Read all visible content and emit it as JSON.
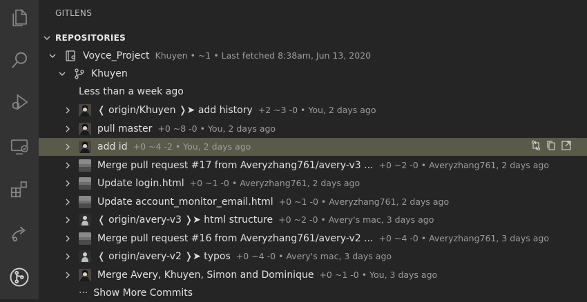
{
  "activity_icons": [
    "files-icon",
    "search-icon",
    "run-debug-icon",
    "remote-explorer-icon",
    "extensions-icon",
    "live-share-icon",
    "gitlens-icon"
  ],
  "header": {
    "title": "GITLENS"
  },
  "section": {
    "label": "REPOSITORIES"
  },
  "repo": {
    "name": "Voyce_Project",
    "meta": "Khuyen • ~1 • Last fetched 8:38am, Jun 13, 2020"
  },
  "branch": {
    "name": "Khuyen"
  },
  "group": {
    "label": "Less than a week ago"
  },
  "commits": [
    {
      "msg": "❬ origin/Khuyen ❭➤ add history",
      "meta": "+2 ~3 -0 • You, 2 days ago",
      "avatar": "person"
    },
    {
      "msg": "pull master",
      "meta": "+0 ~8 -0 • You, 2 days ago",
      "avatar": "person"
    },
    {
      "msg": "add id",
      "meta": "+0 ~4 -2 • You, 2 days ago",
      "avatar": "person"
    },
    {
      "msg": "Merge pull request #17 from Averyzhang761/avery-v3 ...",
      "meta": "+0 ~2 -0 • Averyzhang761, 2 days ago",
      "avatar": "landscape"
    },
    {
      "msg": "Update login.html",
      "meta": "+0 ~1 -0 • Averyzhang761, 2 days ago",
      "avatar": "landscape"
    },
    {
      "msg": "Update account_monitor_email.html",
      "meta": "+0 ~1 -0 • Averyzhang761, 2 days ago",
      "avatar": "landscape"
    },
    {
      "msg": "❬ origin/avery-v3 ❭➤ html structure",
      "meta": "+0 ~2 -0 • Avery's mac, 3 days ago",
      "avatar": "figure"
    },
    {
      "msg": "Merge pull request #16 from Averyzhang761/avery-v2 ...",
      "meta": "+0 ~4 -0 • Averyzhang761, 3 days ago",
      "avatar": "landscape"
    },
    {
      "msg": "❬ origin/avery-v2 ❭➤ typos",
      "meta": "+0 ~4 -0 • Avery's mac, 3 days ago",
      "avatar": "figure"
    },
    {
      "msg": "Merge Avery, Khuyen, Simon and Dominique",
      "meta": "+0 ~1 -0 • You, 3 days ago",
      "avatar": "person"
    }
  ],
  "show_more": {
    "label": "Show More Commits",
    "prefix": "···"
  },
  "selected_actions": [
    "compare-icon",
    "copy-icon",
    "open-external-icon"
  ],
  "colors": {
    "activity_bg": "#333333",
    "sidebar_bg": "#252526",
    "selection_bg": "#5a5a4a",
    "text_dim": "#9d9d9d"
  }
}
